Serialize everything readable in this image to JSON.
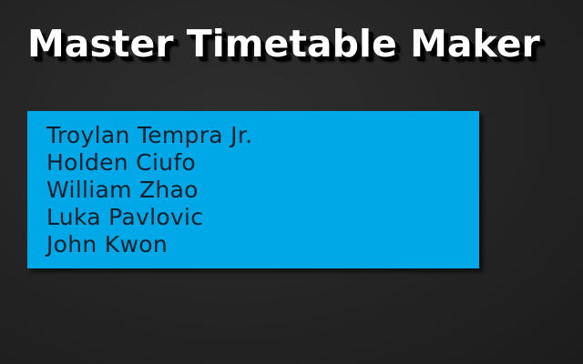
{
  "app": {
    "title": "Master Timetable Maker"
  },
  "credits": {
    "names": [
      "Troylan Tempra Jr.",
      "Holden Ciufo",
      "William Zhao",
      "Luka Pavlovic",
      "John Kwon"
    ]
  },
  "colors": {
    "background": "#262626",
    "panel": "#00a8e8",
    "title_text": "#ffffff",
    "name_text": "#0d1f2a"
  }
}
